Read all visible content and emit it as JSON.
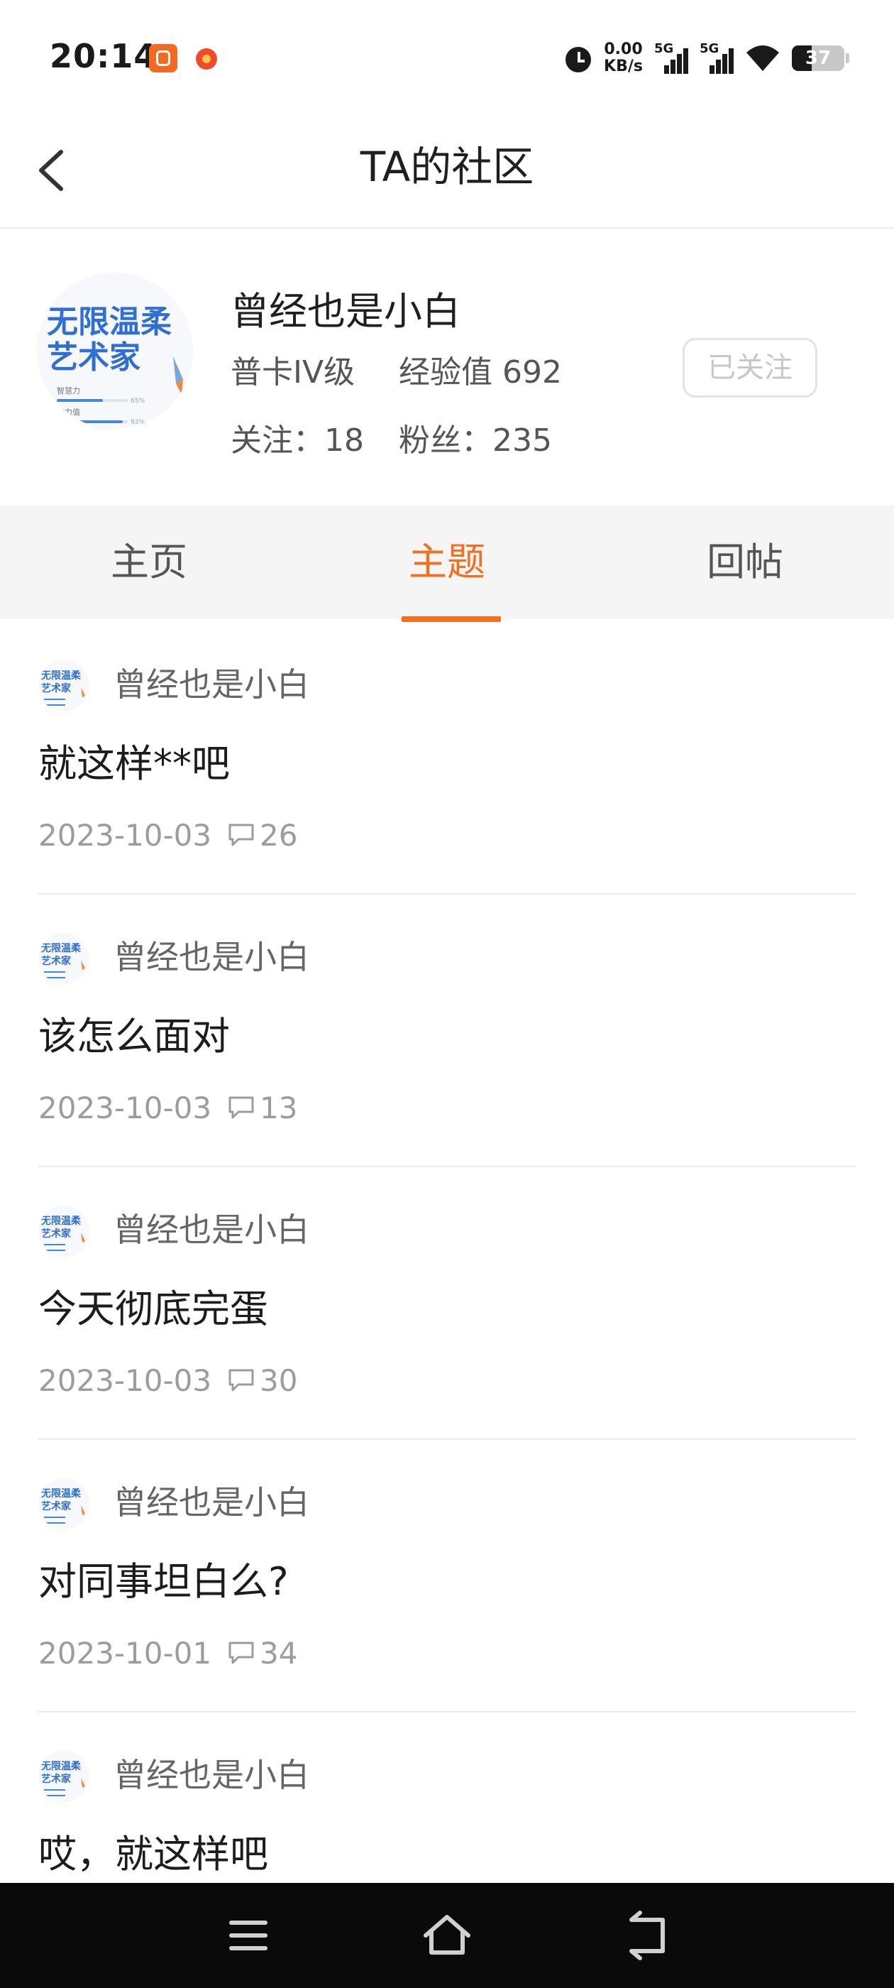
{
  "status_bar": {
    "time": "20:14",
    "net_speed_value": "0.00",
    "net_speed_unit": "KB/s",
    "sim1_label": "5G",
    "sim2_label": "5G",
    "battery": "37",
    "icons": [
      "app-notification-icon",
      "app-notification-icon-2",
      "alarm-icon",
      "signal-icon",
      "wifi-icon",
      "battery-icon"
    ]
  },
  "nav": {
    "back_icon": "chevron-left-icon",
    "title": "TA的社区"
  },
  "profile": {
    "username": "曾经也是小白",
    "level": "普卡IV级",
    "exp": "经验值 692",
    "following": "关注：18",
    "fans": "粉丝：235",
    "follow_button": "已关注",
    "avatar": {
      "line1": "无限温柔",
      "line2": "艺术家",
      "stat1_label": "智慧力",
      "stat1_value": "65%",
      "stat2_label": "魅力值",
      "stat2_value": "93%"
    }
  },
  "tabs": [
    {
      "label": "主页",
      "active": false
    },
    {
      "label": "主题",
      "active": true
    },
    {
      "label": "回帖",
      "active": false
    }
  ],
  "posts": [
    {
      "author": "曾经也是小白",
      "title": "就这样**吧",
      "date": "2023-10-03",
      "comments": "26"
    },
    {
      "author": "曾经也是小白",
      "title": "该怎么面对",
      "date": "2023-10-03",
      "comments": "13"
    },
    {
      "author": "曾经也是小白",
      "title": "今天彻底完蛋",
      "date": "2023-10-03",
      "comments": "30"
    },
    {
      "author": "曾经也是小白",
      "title": "对同事坦白么?",
      "date": "2023-10-01",
      "comments": "34"
    },
    {
      "author": "曾经也是小白",
      "title": "哎，就这样吧",
      "date": "",
      "comments": ""
    }
  ],
  "system_nav": [
    "menu-icon",
    "home-icon",
    "back-icon"
  ],
  "colors": {
    "accent": "#f07020",
    "tab_bg": "#f5f5f5",
    "system_bar": "#0a0a0a"
  }
}
